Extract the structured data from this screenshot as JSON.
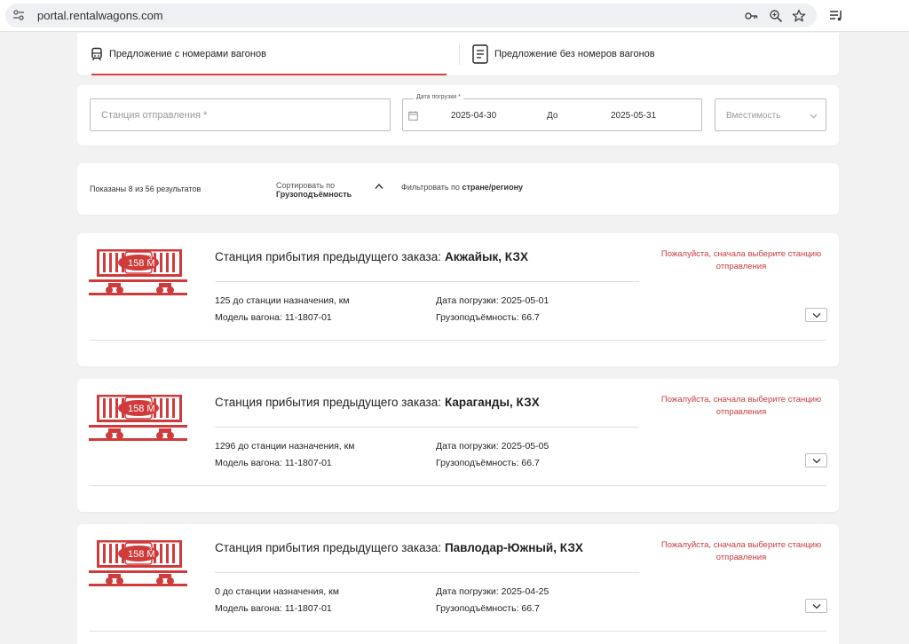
{
  "browser": {
    "url": "portal.rentalwagons.com"
  },
  "tabs": [
    {
      "label": "Предложение с номерами вагонов"
    },
    {
      "label": "Предложение без номеров вагонов"
    }
  ],
  "filters": {
    "station_placeholder": "Станция отправления *",
    "date_legend": "Дата погрузки *",
    "date_from": "2025-04-30",
    "date_to_label": "До",
    "date_to": "2025-05-31",
    "capacity_placeholder": "Вместимость"
  },
  "sortbar": {
    "results": "Показаны 8 из 56 результатов",
    "sort_label": "Сортировать по",
    "sort_value": "Грузоподъёмность",
    "filter_prefix": "Фильтровать по",
    "filter_value": "стране/региону"
  },
  "results": [
    {
      "volume": "158 М",
      "volume_exp": "3",
      "title": "Станция прибытия предыдущего заказа:",
      "city": "Акжайык, КЗХ",
      "distance": "125 до станции назначения, км",
      "model": "Модель вагона: 11-1807-01",
      "date": "Дата погрузки: 2025-05-01",
      "capacity": "Грузоподъёмность: 66.7",
      "warning": "Пожалуйста, сначала выберите станцию отправления"
    },
    {
      "volume": "158 М",
      "volume_exp": "3",
      "title": "Станция прибытия предыдущего заказа:",
      "city": "Караганды, КЗХ",
      "distance": "1296 до станции назначения, км",
      "model": "Модель вагона: 11-1807-01",
      "date": "Дата погрузки: 2025-05-05",
      "capacity": "Грузоподъёмность: 66.7",
      "warning": "Пожалуйста, сначала выберите станцию отправления"
    },
    {
      "volume": "158 М",
      "volume_exp": "3",
      "title": "Станция прибытия предыдущего заказа:",
      "city": "Павлодар-Южный, КЗХ",
      "distance": "0 до станции назначения, км",
      "model": "Модель вагона: 11-1807-01",
      "date": "Дата погрузки: 2025-04-25",
      "capacity": "Грузоподъёмность: 66.7",
      "warning": "Пожалуйста, сначала выберите станцию отправления"
    }
  ],
  "colors": {
    "accent": "#d9433e",
    "wagon": "#cf3b3b",
    "warning": "#c93b3b"
  }
}
